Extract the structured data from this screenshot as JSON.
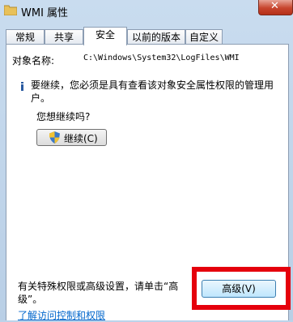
{
  "window": {
    "title": "WMI 属性"
  },
  "tabs": [
    {
      "label": "常规"
    },
    {
      "label": "共享"
    },
    {
      "label": "安全"
    },
    {
      "label": "以前的版本"
    },
    {
      "label": "自定义"
    }
  ],
  "active_tab": "安全",
  "security": {
    "object_name_label": "对象名称:",
    "object_name_value": "C:\\Windows\\System32\\LogFiles\\WMI",
    "notice": "要继续，您必须是具有查看该对象安全属性权限的管理用户。",
    "question": "您想继续吗?",
    "continue_button": "继续(C)",
    "advanced_text": "有关特殊权限或高级设置，请单击“高级”。",
    "advanced_button": "高级(V)",
    "help_link": "了解访问控制和权限"
  },
  "colors": {
    "highlight": "#e5000c",
    "link": "#0066cc"
  },
  "icons": [
    "folder-icon",
    "close-icon",
    "info-icon",
    "uac-shield-icon"
  ]
}
